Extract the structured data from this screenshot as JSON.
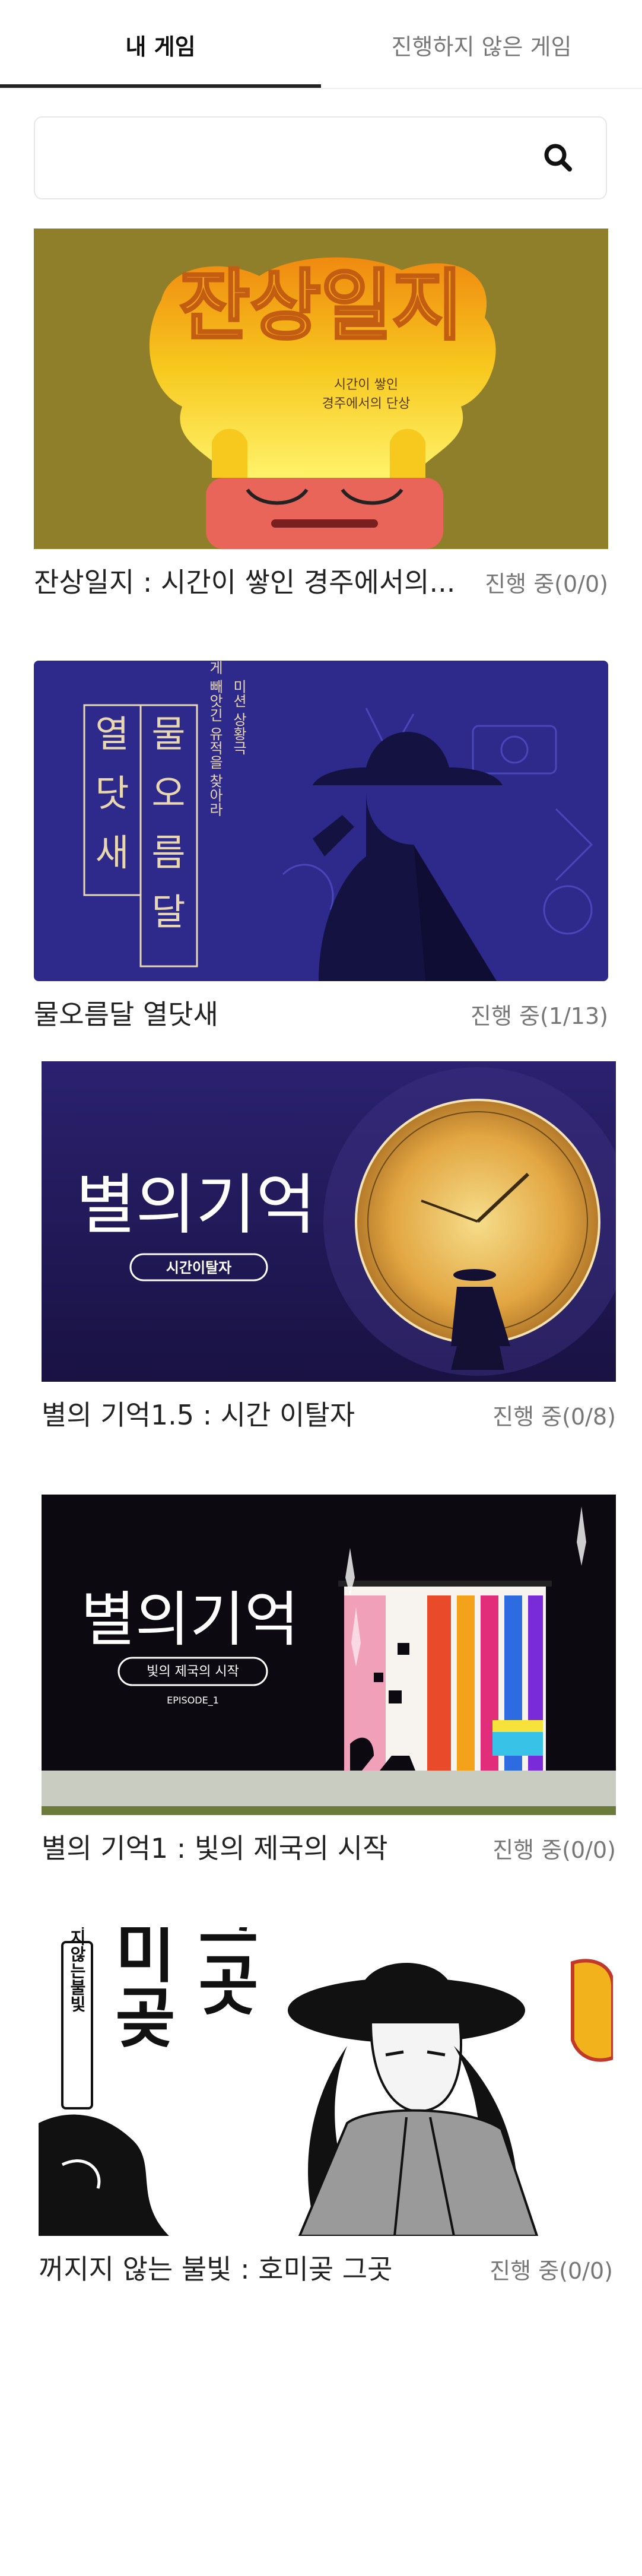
{
  "tabs": [
    {
      "label": "내 게임",
      "active": true
    },
    {
      "label": "진행하지 않은 게임",
      "active": false
    }
  ],
  "search": {
    "placeholder": "",
    "value": "",
    "icon": "search-icon"
  },
  "games": [
    {
      "title": "잔상일지 : 시간이 쌓인 경주에서의...",
      "status": "진행 중(0/0)",
      "cover": {
        "logo": "잔상일지",
        "tagline_1": "시간이 쌓인",
        "tagline_2": "경주에서의 단상",
        "bg": "#8f7f2a",
        "accent": "#f5c41a"
      }
    },
    {
      "title": "물오름달 열닷새",
      "status": "진행 중(1/13)",
      "cover": {
        "col_1": "물오름달",
        "col_2": "열닷새",
        "tagline_1": "미션 상황극",
        "tagline_2": "일본에게 빼앗긴 유적을 찾아라",
        "bg": "#2e2a8c",
        "accent": "#e8d7b0"
      }
    },
    {
      "title": "별의 기억1.5 : 시간 이탈자",
      "status": "진행 중(0/8)",
      "cover": {
        "logo": "별의기억",
        "subtitle": "시간이탈자",
        "bg": "#241d5c",
        "accent": "#f2c66a"
      }
    },
    {
      "title": "별의 기억1 : 빛의 제국의 시작",
      "status": "진행 중(0/0)",
      "cover": {
        "logo": "별의기억",
        "subtitle": "빛의 제국의 시작",
        "episode": "EPISODE_1",
        "bg": "#0c0a10",
        "accent": "#ffffff"
      }
    },
    {
      "title": "꺼지지 않는 불빛 : 호미곶 그곳",
      "status": "진행 중(0/0)",
      "cover": {
        "label": "꺼지지않는불빛",
        "logo_1": "호미곶",
        "logo_2": "그곳",
        "bg": "#ffffff",
        "accent": "#f2b21c"
      }
    }
  ]
}
